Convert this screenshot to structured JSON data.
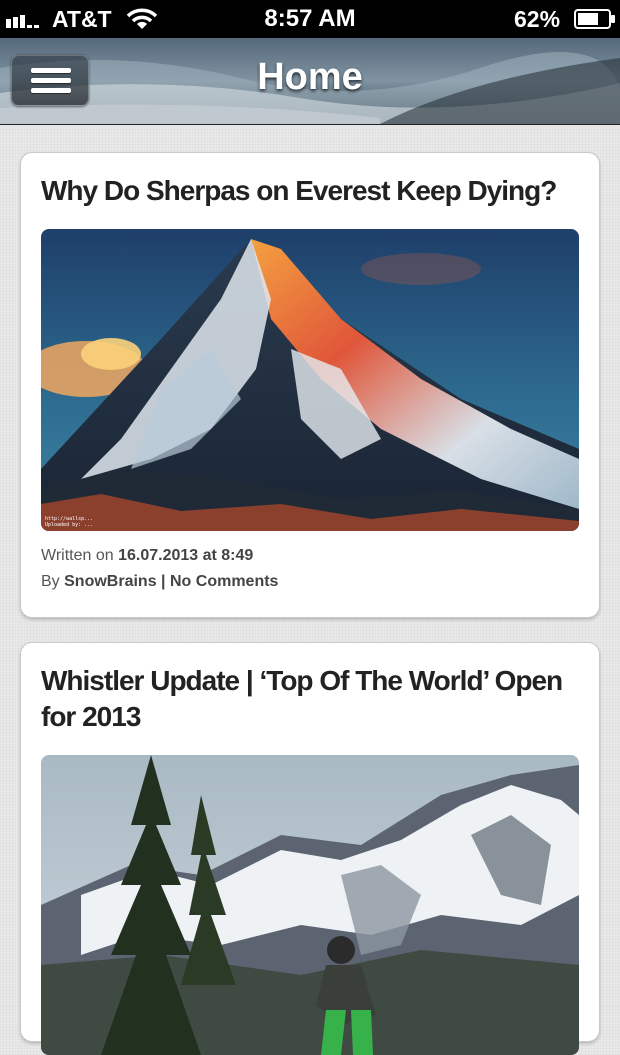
{
  "status_bar": {
    "carrier": "AT&T",
    "time": "8:57 AM",
    "battery": "62%"
  },
  "header": {
    "title": "Home"
  },
  "posts": [
    {
      "title": "Why Do Sherpas on Everest Keep Dying?",
      "written_label": "Written on",
      "date": "16.07.2013 at 8:49",
      "by_label": "By",
      "author": "SnowBrains",
      "separator": "|",
      "comments": "No Comments",
      "image_watermark_1": "http://wallsp...",
      "image_watermark_2": "Uploaded by: ...",
      "image_icon": "mountain-peak-sunset-image"
    },
    {
      "title": "Whistler Update | ‘Top Of The World’ Open for 2013",
      "image_icon": "mountain-biker-image"
    }
  ],
  "colors": {
    "status_bar_bg": "#000000",
    "card_bg": "#ffffff",
    "page_bg": "#e9e9e9",
    "title_text": "#222222"
  }
}
